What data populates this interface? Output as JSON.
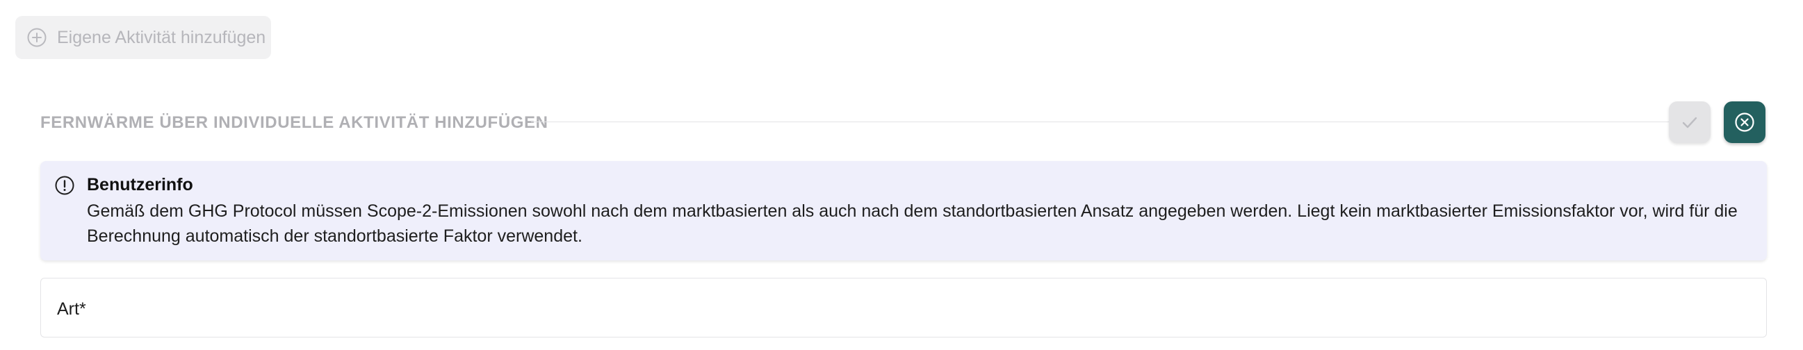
{
  "add_activity": {
    "label": "Eigene Aktivität hinzufügen",
    "icon": "plus-circle-icon"
  },
  "section": {
    "title": "FERNWÄRME ÜBER INDIVIDUELLE AKTIVITÄT HINZUFÜGEN",
    "confirm_icon": "check-icon",
    "cancel_icon": "close-circle-icon"
  },
  "info": {
    "icon": "exclamation-circle-icon",
    "title": "Benutzerinfo",
    "text": "Gemäß dem GHG Protocol müssen Scope-2-Emissionen sowohl nach dem marktbasierten als auch nach dem standortbasierten Ansatz angegeben werden. Liegt kein marktbasierter Emissionsfaktor vor, wird für die Berechnung automatisch der standortbasierte Faktor verwendet."
  },
  "form": {
    "art_label": "Art*"
  },
  "colors": {
    "accent": "#23605f",
    "info_background": "#efeffb",
    "disabled_text": "#b6b6bb"
  }
}
